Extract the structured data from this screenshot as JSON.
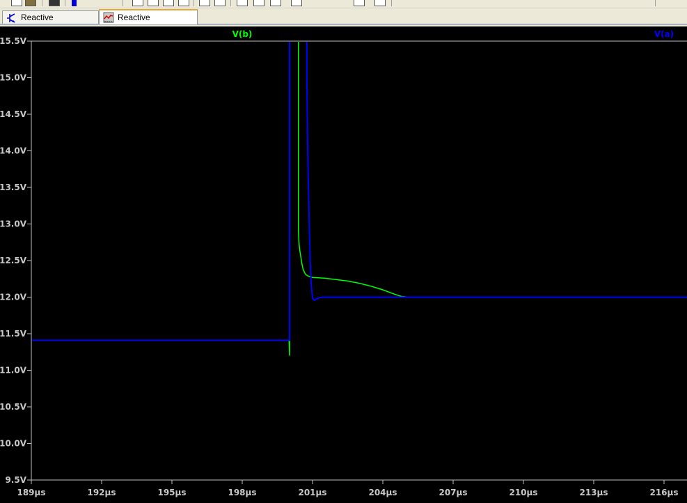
{
  "tabs": [
    {
      "label": "Reactive damping.asc",
      "icon": "schematic-icon",
      "active": false
    },
    {
      "label": "Reactive damping.raw",
      "icon": "waveform-icon",
      "active": true
    }
  ],
  "chart_data": {
    "type": "line",
    "xlabel": "",
    "ylabel": "",
    "xlim": [
      189,
      216.98
    ],
    "ylim": [
      9.5,
      15.5
    ],
    "x_ticks": [
      "189µs",
      "192µs",
      "195µs",
      "198µs",
      "201µs",
      "204µs",
      "207µs",
      "210µs",
      "213µs",
      "216µs"
    ],
    "x_tick_values": [
      189,
      192,
      195,
      198,
      201,
      204,
      207,
      210,
      213,
      216
    ],
    "y_ticks": [
      "15.5V",
      "15.0V",
      "14.5V",
      "14.0V",
      "13.5V",
      "13.0V",
      "12.5V",
      "12.0V",
      "11.5V",
      "11.0V",
      "10.5V",
      "10.0V",
      "9.5V"
    ],
    "y_tick_values": [
      15.5,
      15.0,
      14.5,
      14.0,
      13.5,
      13.0,
      12.5,
      12.0,
      11.5,
      11.0,
      10.5,
      10.0,
      9.5
    ],
    "background": "#000000",
    "axis_color": "#c0c0c0",
    "series": [
      {
        "name": "V(b)",
        "color": "#00ff00",
        "x": [
          200.0,
          200.02,
          200.02,
          200.4,
          200.4,
          200.42,
          200.45,
          200.5,
          200.55,
          200.6,
          200.7,
          200.8,
          200.9,
          201.0,
          201.5,
          202.0,
          202.5,
          203.0,
          203.5,
          204.0,
          204.5,
          204.8,
          205.1
        ],
        "y": [
          11.4,
          11.2,
          15.6,
          15.6,
          12.9,
          12.75,
          12.65,
          12.55,
          12.45,
          12.38,
          12.31,
          12.29,
          12.28,
          12.27,
          12.26,
          12.24,
          12.22,
          12.19,
          12.15,
          12.1,
          12.04,
          12.01,
          12.0
        ]
      },
      {
        "name": "V(a)",
        "color": "#0000ff",
        "x": [
          189,
          200.0,
          200.02,
          200.02,
          200.03,
          200.76,
          200.76,
          200.78,
          200.82,
          200.86,
          200.9,
          200.95,
          201.0,
          201.05,
          201.1,
          201.2,
          201.4,
          202,
          205,
          216.98
        ],
        "y": [
          11.41,
          11.41,
          11.41,
          15.6,
          15.6,
          15.6,
          15.0,
          14.3,
          13.6,
          13.0,
          12.5,
          12.15,
          11.99,
          11.96,
          11.96,
          11.98,
          12.0,
          12.0,
          12.0,
          12.0
        ]
      }
    ]
  }
}
